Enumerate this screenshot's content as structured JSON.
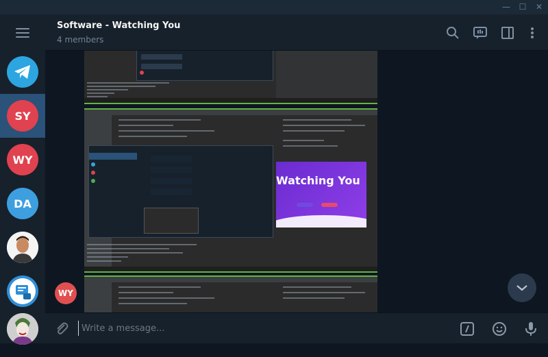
{
  "window": {
    "minimize_glyph": "—",
    "maximize_glyph": "☐",
    "close_glyph": "✕"
  },
  "sidebar": {
    "items": [
      {
        "name": "telegram",
        "icon": "telegram-logo-icon",
        "color": "#2ca5e0"
      },
      {
        "initials": "SY",
        "color": "#e0424f",
        "active": true
      },
      {
        "initials": "WY",
        "color": "#e0424f"
      },
      {
        "initials": "DA",
        "color": "#3d9fe0"
      },
      {
        "name": "person-photo",
        "icon": "person-photo-avatar"
      },
      {
        "name": "bot",
        "icon": "bot-avatar",
        "color": "#2f8fd8"
      },
      {
        "name": "joker",
        "icon": "joker-photo-avatar"
      }
    ]
  },
  "header": {
    "title": "Software - Watching You",
    "subtitle": "4 members",
    "icons": [
      "search-icon",
      "poll-icon",
      "sidebar-toggle-icon",
      "more-vertical-icon"
    ]
  },
  "messages": {
    "sender_initials": "WY",
    "sender_color": "#e0424f",
    "embedded_banner_text": "Watching You"
  },
  "composer": {
    "placeholder": "Write a message...",
    "icons": [
      "attach-icon",
      "command-icon",
      "emoji-icon",
      "microphone-icon"
    ]
  },
  "colors": {
    "accent": "#2b5278",
    "background": "#0e1621",
    "panel": "#17212b"
  }
}
